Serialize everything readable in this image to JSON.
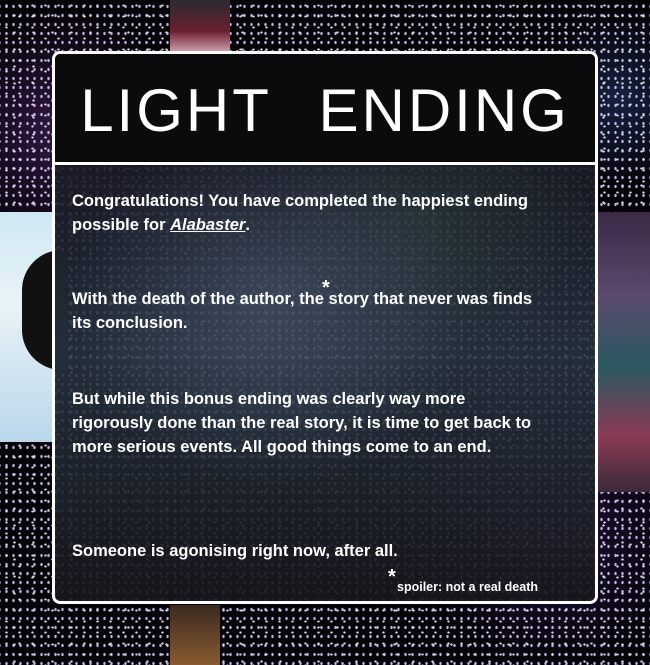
{
  "title": "LIGHT   ENDING",
  "paragraphs": {
    "p1_before": "Congratulations! You have completed the happiest ending possible for ",
    "p1_game": "Alabaster",
    "p1_after": ".",
    "p2_before": "With the death of the author",
    "p2_after": ", the story that never was finds its conclusion.",
    "p3": "But while this bonus ending was clearly way more rigorously done than the real story, it is time to get back to more serious events. All good things come to an end.",
    "p4": "Someone is agonising right now, after all."
  },
  "asterisk": "*",
  "footnote": "spoiler: not a real death"
}
